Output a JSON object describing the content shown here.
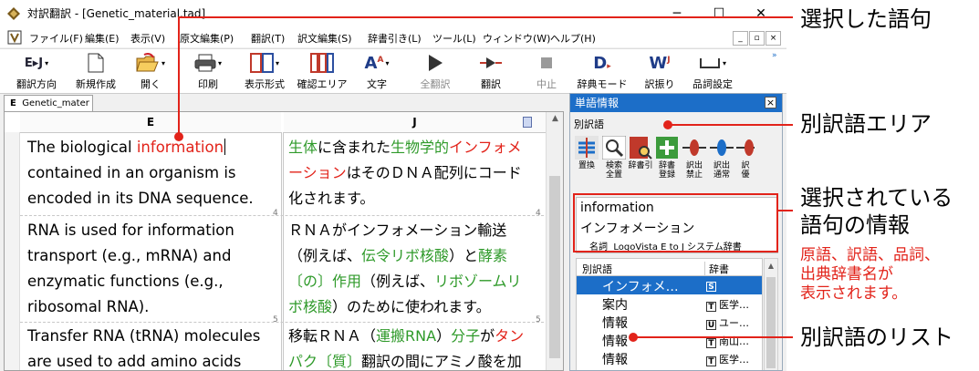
{
  "window": {
    "title": "対訳翻訳 - [Genetic_material.tad]",
    "controls": [
      "─",
      "☐",
      "✕"
    ]
  },
  "menubar": [
    "ファイル(F)",
    "編集(E)",
    "表示(V)",
    "原文編集(P)",
    "翻訳(T)",
    "訳文編集(S)",
    "辞書引き(L)",
    "ツール(L)",
    "ウィンドウ(W)",
    "ヘルプ(H)"
  ],
  "mdi_controls": [
    "_",
    "▫",
    "×"
  ],
  "toolbar": [
    {
      "label": "翻訳方向",
      "icon": "ej-direction-icon",
      "enabled": true
    },
    {
      "label": "新規作成",
      "icon": "new-document-icon",
      "enabled": true
    },
    {
      "label": "開く",
      "icon": "open-folder-icon",
      "enabled": true
    },
    {
      "label": "印刷",
      "icon": "printer-icon",
      "enabled": true
    },
    {
      "label": "表示形式",
      "icon": "layout-icon",
      "enabled": true
    },
    {
      "label": "確認エリア",
      "icon": "confirm-area-icon",
      "enabled": true
    },
    {
      "label": "文字",
      "icon": "font-icon",
      "enabled": true
    },
    {
      "label": "全翻訳",
      "icon": "play-icon",
      "enabled": false
    },
    {
      "label": "翻訳",
      "icon": "translate-icon",
      "enabled": true
    },
    {
      "label": "中止",
      "icon": "stop-icon",
      "enabled": false
    },
    {
      "label": "辞典モード",
      "icon": "dictionary-mode-icon",
      "enabled": true
    },
    {
      "label": "訳振り",
      "icon": "furigana-icon",
      "enabled": true
    },
    {
      "label": "品詞設定",
      "icon": "pos-setting-icon",
      "enabled": true
    }
  ],
  "toolbar_small": {
    "direction": "E▸J",
    "dictionary": "D",
    "furi": "W",
    "font": "A"
  },
  "document": {
    "tab_prefix": "E",
    "tab_label": "Genetic_mater",
    "col_src": "E",
    "col_tgt": "J",
    "rows": [
      {
        "number": "4",
        "src": [
          [
            {
              "t": "The biological "
            },
            {
              "t": "information",
              "c": "red"
            }
          ],
          [
            {
              "t": "contained in an organism is"
            }
          ],
          [
            {
              "t": "encoded in its DNA sequence."
            }
          ]
        ],
        "tgt": [
          [
            {
              "t": "生体",
              "c": "grn"
            },
            {
              "t": "に含まれた"
            },
            {
              "t": "生物学的",
              "c": "grn"
            },
            {
              "t": "インフォメ",
              "c": "red"
            }
          ],
          [
            {
              "t": "ーション",
              "c": "red"
            },
            {
              "t": "はそのＤＮＡ配列にコード"
            }
          ],
          [
            {
              "t": "化されます。"
            }
          ]
        ]
      },
      {
        "number": "5",
        "src": [
          [
            {
              "t": "RNA is used for information"
            }
          ],
          [
            {
              "t": "transport (e.g., mRNA) and"
            }
          ],
          [
            {
              "t": "enzymatic functions (e.g.,"
            }
          ],
          [
            {
              "t": "ribosomal RNA)."
            }
          ]
        ],
        "tgt": [
          [
            {
              "t": "ＲＮＡがインフォメーション輸送"
            }
          ],
          [
            {
              "t": "（例えば、"
            },
            {
              "t": "伝令リボ核酸",
              "c": "grn"
            },
            {
              "t": "）と"
            },
            {
              "t": "酵素",
              "c": "grn"
            }
          ],
          [
            {
              "t": "〔の〕作用",
              "c": "grn"
            },
            {
              "t": "（例えば、"
            },
            {
              "t": "リボゾームリ",
              "c": "grn"
            }
          ],
          [
            {
              "t": "ボ核酸",
              "c": "grn"
            },
            {
              "t": "）のために使われます。"
            }
          ]
        ]
      },
      {
        "number": "",
        "src": [
          [
            {
              "t": "Transfer RNA (tRNA) molecules"
            }
          ],
          [
            {
              "t": "are used to add amino acids"
            }
          ]
        ],
        "tgt": [
          [
            {
              "t": "移転ＲＮＡ（"
            },
            {
              "t": "運搬RNA",
              "c": "grn"
            },
            {
              "t": "）"
            },
            {
              "t": "分子",
              "c": "grn"
            },
            {
              "t": "が"
            },
            {
              "t": "タン",
              "c": "red"
            }
          ],
          [
            {
              "t": "パク〔質〕",
              "c": "grn"
            },
            {
              "t": "翻訳の間にアミノ酸を加"
            }
          ]
        ]
      }
    ]
  },
  "panel": {
    "title": "単語情報",
    "close": "×",
    "alt_header": "別訳語",
    "buttons": [
      {
        "label": "置換",
        "icon": "replace-icon"
      },
      {
        "label": "検索\n全置",
        "icon": "search-replace-all-icon"
      },
      {
        "label": "辞書引",
        "icon": "dictionary-lookup-icon"
      },
      {
        "label": "辞書\n登録",
        "icon": "dictionary-register-icon"
      },
      {
        "label": "訳出\n禁止",
        "icon": "ban-translation-icon"
      },
      {
        "label": "訳出\n通常",
        "icon": "normal-translation-icon"
      },
      {
        "label": "訳\n優",
        "icon": "priority-translation-icon"
      }
    ],
    "info": {
      "source": "information",
      "target": "インフォメーション",
      "pos": "名詞",
      "dictionary": "LogoVista E to J システム辞書"
    },
    "list_headers": [
      "別訳語",
      "辞書"
    ],
    "list": [
      {
        "word": "インフォメ…",
        "dict": "",
        "icon": "S",
        "selected": true
      },
      {
        "word": "案内",
        "dict": "医学…",
        "icon": "T",
        "selected": false
      },
      {
        "word": "情報",
        "dict": "ユー…",
        "icon": "U",
        "selected": false
      },
      {
        "word": "情報",
        "dict": "南山…",
        "icon": "T",
        "selected": false
      },
      {
        "word": "情報",
        "dict": "医学…",
        "icon": "T",
        "selected": false
      }
    ]
  },
  "callouts": {
    "selected_phrase": "選択した語句",
    "alt_area": "別訳語エリア",
    "selected_info": "選択されている\n語句の情報",
    "info_note": "原語、訳語、品詞、\n出典辞書名が\n表示されます。",
    "alt_list": "別訳語のリスト"
  },
  "colors": {
    "accent": "#e2231a",
    "panel_title": "#1c6ec8",
    "green_term": "#2f9a2a"
  }
}
